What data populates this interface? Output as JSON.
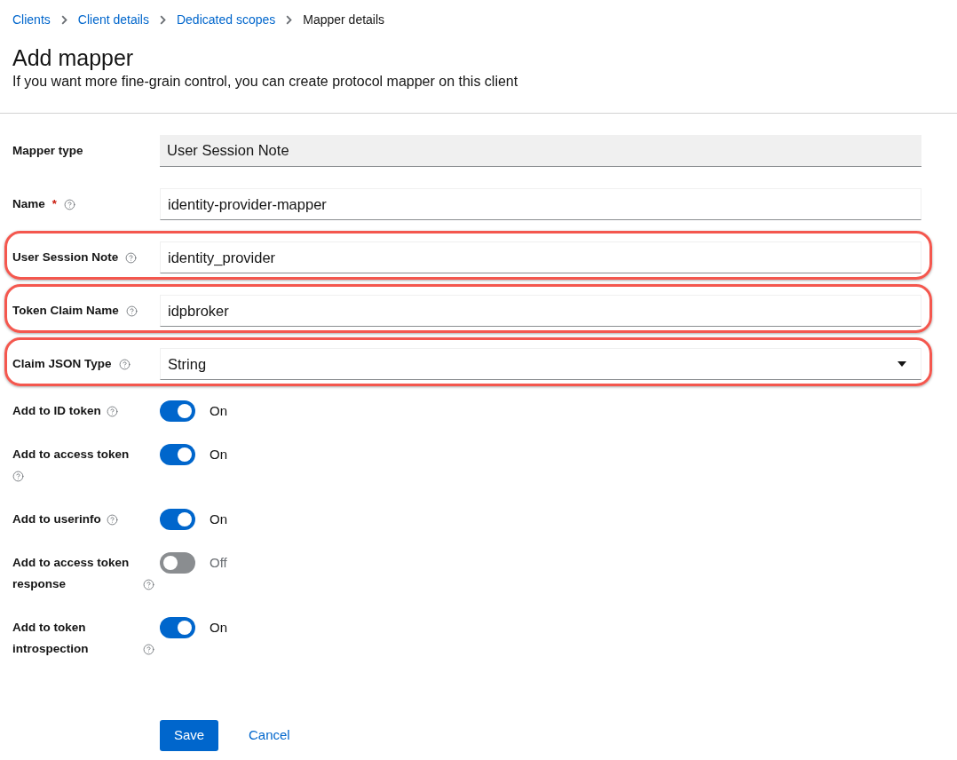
{
  "breadcrumb": [
    {
      "label": "Clients",
      "current": false
    },
    {
      "label": "Client details",
      "current": false
    },
    {
      "label": "Dedicated scopes",
      "current": false
    },
    {
      "label": "Mapper details",
      "current": true
    }
  ],
  "title": "Add mapper",
  "subtitle": "If you want more fine-grain control, you can create protocol mapper on this client",
  "fields": [
    {
      "kind": "readonly",
      "label": "Mapper type",
      "help": false,
      "value": "User Session Note",
      "highlighted": false
    },
    {
      "kind": "text",
      "label": "Name",
      "required_mark": "*",
      "help": true,
      "value": "identity-provider-mapper",
      "highlighted": false
    },
    {
      "kind": "text",
      "label": "User Session Note",
      "help": true,
      "value": "identity_provider",
      "highlighted": true
    },
    {
      "kind": "text",
      "label": "Token Claim Name",
      "help": true,
      "value": "idpbroker",
      "highlighted": true
    },
    {
      "kind": "select",
      "label": "Claim JSON Type",
      "help": true,
      "value": "String",
      "highlighted": true
    }
  ],
  "toggles": [
    {
      "label": "Add to ID token",
      "on": true,
      "state_label": "On"
    },
    {
      "label": "Add to access token",
      "on": true,
      "state_label": "On"
    },
    {
      "label": "Add to userinfo",
      "on": true,
      "state_label": "On"
    },
    {
      "label": "Add to access token response",
      "on": false,
      "state_label": "Off"
    },
    {
      "label": "Add to token introspection",
      "on": true,
      "state_label": "On"
    }
  ],
  "actions": {
    "save": "Save",
    "cancel": "Cancel"
  }
}
